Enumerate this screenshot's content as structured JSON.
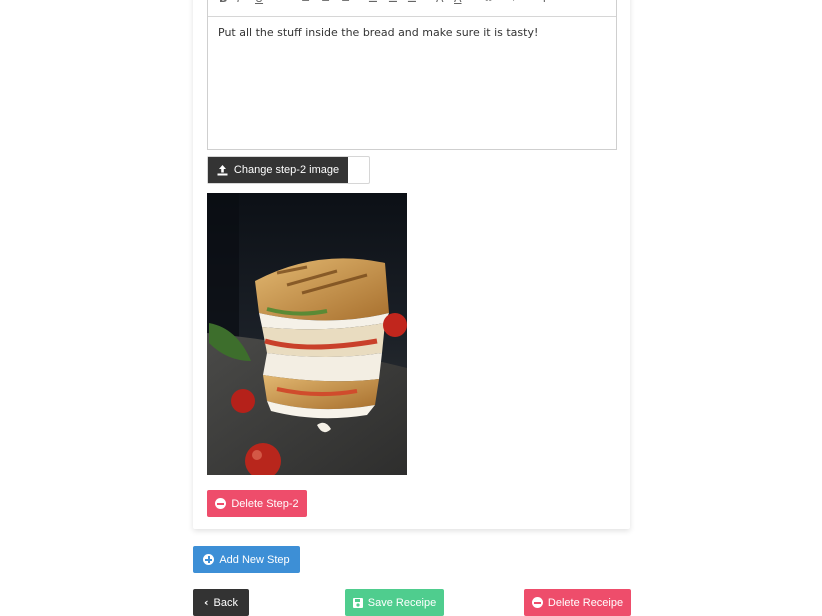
{
  "editor": {
    "content": "Put all the stuff inside the bread and make sure it is tasty!",
    "toolbar_icons": [
      "bold-icon",
      "italic-icon",
      "underline-icon",
      "quote-icon",
      "align-left-icon",
      "align-center-icon",
      "align-right-icon",
      "ordered-list-icon",
      "unordered-list-icon",
      "checklist-icon",
      "text-background-icon",
      "text-color-icon",
      "link-icon",
      "code-icon",
      "clear-format-icon"
    ]
  },
  "step": {
    "change_image_label": "Change step-2 image",
    "delete_label": "Delete Step-2"
  },
  "actions": {
    "add_step_label": "Add New Step",
    "back_label": "Back",
    "save_label": "Save Receipe",
    "delete_label": "Delete Receipe"
  },
  "colors": {
    "danger": "#ee4d6b",
    "primary": "#3d8fd6",
    "dark": "#333333",
    "success": "#4fcd8e"
  }
}
